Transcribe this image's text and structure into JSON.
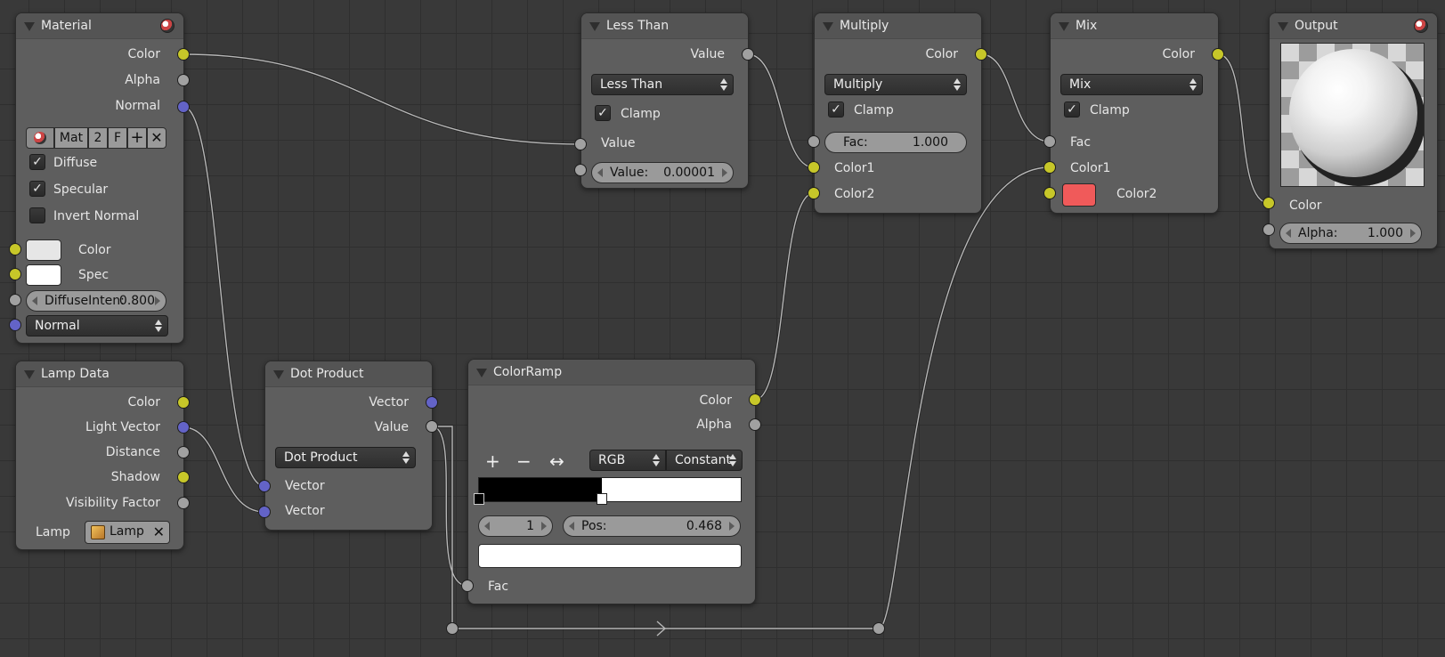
{
  "colors": {
    "canvas": "#393939",
    "node_body": "#5e5e5e",
    "node_header": "#545454",
    "socket_color": "#c7c729",
    "socket_value": "#a1a1a1",
    "socket_vector": "#6363c7",
    "mix_color2": "#f05a5a",
    "swatch_light": "#e6e6e6",
    "swatch_white": "#ffffff"
  },
  "material": {
    "title": "Material",
    "header_icon": "material-sphere-icon",
    "outputs": {
      "color": "Color",
      "alpha": "Alpha",
      "normal": "Normal"
    },
    "datablock": {
      "icon": "material-sphere-icon",
      "name": "Mat",
      "users": "2",
      "fake": "F",
      "add_icon": "plus-icon",
      "remove_icon": "close-icon"
    },
    "checkboxes": [
      {
        "label": "Diffuse",
        "checked": true
      },
      {
        "label": "Specular",
        "checked": true
      },
      {
        "label": "Invert Normal",
        "checked": false
      }
    ],
    "inputs": {
      "color": "Color",
      "spec": "Spec"
    },
    "diffuse_intensity": {
      "label": "DiffuseInten:",
      "value": "0.800"
    },
    "normal_dropdown": "Normal"
  },
  "lamp_data": {
    "title": "Lamp Data",
    "outputs": [
      "Color",
      "Light Vector",
      "Distance",
      "Shadow",
      "Visibility Factor"
    ],
    "lamp_label": "Lamp",
    "lamp_selector": {
      "icon": "lamp-icon",
      "name": "Lamp",
      "remove_icon": "close-icon"
    }
  },
  "dot_product": {
    "title": "Dot Product",
    "outputs": {
      "vector": "Vector",
      "value": "Value"
    },
    "operation": "Dot Product",
    "inputs": [
      "Vector",
      "Vector"
    ]
  },
  "color_ramp": {
    "title": "ColorRamp",
    "outputs": {
      "color": "Color",
      "alpha": "Alpha"
    },
    "toolbar": {
      "add_icon": "plus-icon",
      "remove_icon": "minus-icon",
      "flip_icon": "flip-arrows-icon"
    },
    "color_mode": "RGB",
    "interpolation": "Constant",
    "active_index": "1",
    "position": {
      "label": "Pos:",
      "value": "0.468"
    },
    "stop_position": 0.468,
    "input": "Fac"
  },
  "less_than": {
    "title": "Less Than",
    "output": "Value",
    "operation": "Less Than",
    "clamp": {
      "label": "Clamp",
      "checked": true
    },
    "input": "Value",
    "value_field": {
      "label": "Value:",
      "value": "0.00001"
    }
  },
  "multiply": {
    "title": "Multiply",
    "output": "Color",
    "blend": "Multiply",
    "clamp": {
      "label": "Clamp",
      "checked": true
    },
    "fac": {
      "label": "Fac:",
      "value": "1.000"
    },
    "inputs": [
      "Color1",
      "Color2"
    ]
  },
  "mix": {
    "title": "Mix",
    "output": "Color",
    "blend": "Mix",
    "clamp": {
      "label": "Clamp",
      "checked": true
    },
    "inputs": {
      "fac": "Fac",
      "color1": "Color1",
      "color2": "Color2"
    }
  },
  "output": {
    "title": "Output",
    "header_icon": "material-sphere-icon",
    "preview": "sphere-preview",
    "inputs": {
      "color": "Color"
    },
    "alpha": {
      "label": "Alpha:",
      "value": "1.000"
    }
  },
  "reroute": {
    "midpoint_icon": "chevron-right-icon"
  }
}
